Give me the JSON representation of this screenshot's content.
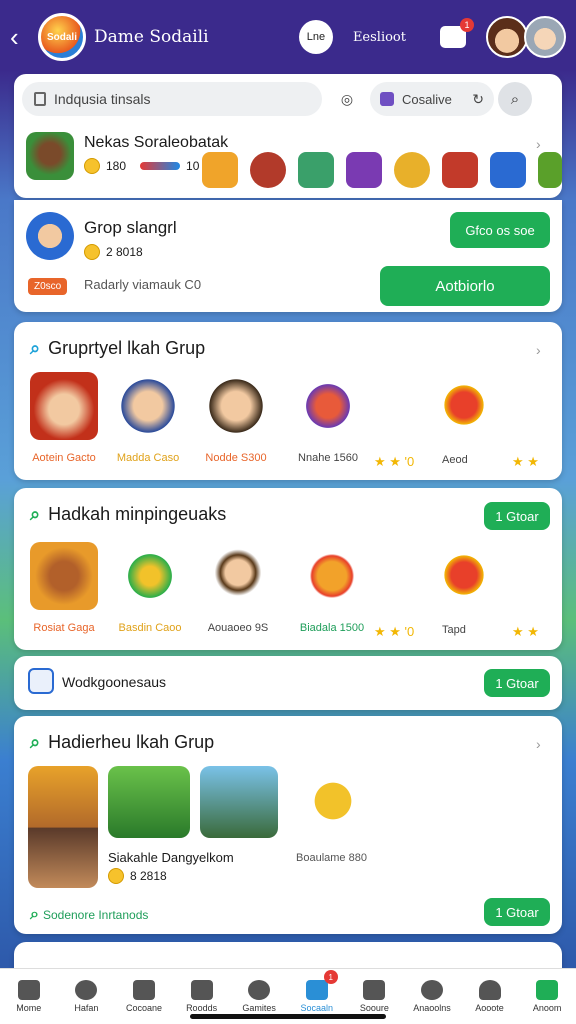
{
  "header": {
    "app_title": "Dame Sodaili",
    "logo_text": "Sodali",
    "pill_label": "Lne",
    "link_label": "Eeslioot",
    "notif_count": "1"
  },
  "search": {
    "placeholder": "Indqusia tinsals",
    "chip_label": "Cosalive"
  },
  "featured": {
    "title": "Nekas Soraleobatak",
    "stat1": "180",
    "stat2": "10"
  },
  "group_card": {
    "title": "Grop slangrl",
    "stat": "2 8018",
    "tag": "Z0sco",
    "subtitle": "Radarly viamauk C0",
    "top_button": "Gfco os soe",
    "main_button": "Aotbiorlo"
  },
  "section1": {
    "title": "Gruprtyel lkah Grup",
    "tiles": [
      {
        "label": "Aotein Gacto",
        "color": "#e8652a"
      },
      {
        "label": "Madda Caso",
        "color": "#e0a21a"
      },
      {
        "label": "Nodde S300",
        "color": "#e8652a"
      },
      {
        "label": "Nnahe 1560",
        "color": "#444444"
      }
    ],
    "stars1": "★ ★ '0",
    "extra_label": "Aeod",
    "stars2": "★ ★"
  },
  "section2": {
    "title": "Hadkah minpingeuaks",
    "button": "1 Gtoar",
    "tiles": [
      {
        "label": "Rosiat Gaga",
        "color": "#e8652a"
      },
      {
        "label": "Basdin Caoo",
        "color": "#e0a21a"
      },
      {
        "label": "Aouaoeo 9S",
        "color": "#444444"
      },
      {
        "label": "Biadala 1500",
        "color": "#1f9e5a"
      }
    ],
    "stars1": "★ ★ '0",
    "extra_label": "Tapd",
    "stars2": "★ ★"
  },
  "workbar": {
    "title": "Wodkgoonesaus",
    "button": "1 Gtoar"
  },
  "section3": {
    "title": "Hadierheu lkah Grup",
    "game_title": "Siakahle Dangyelkom",
    "game_stat": "8 2818",
    "right_label": "Boaulame 880",
    "footer_label": "Sodenore Inrtanods",
    "button": "1 Gtoar"
  },
  "nav": {
    "items": [
      {
        "label": "Mome",
        "active": false
      },
      {
        "label": "Hafan",
        "active": false
      },
      {
        "label": "Cocoane",
        "active": false
      },
      {
        "label": "Roodds",
        "active": false
      },
      {
        "label": "Gamites",
        "active": false
      },
      {
        "label": "Socaaln",
        "active": true,
        "badge": "1"
      },
      {
        "label": "Sooure",
        "active": false
      },
      {
        "label": "Anaoolns",
        "active": false
      },
      {
        "label": "Aooote",
        "active": false
      },
      {
        "label": "Anoom",
        "active": false
      }
    ]
  },
  "colors": {
    "accent_green": "#1fae56",
    "header_purple": "#3b2a8c",
    "badge_red": "#e53935"
  }
}
